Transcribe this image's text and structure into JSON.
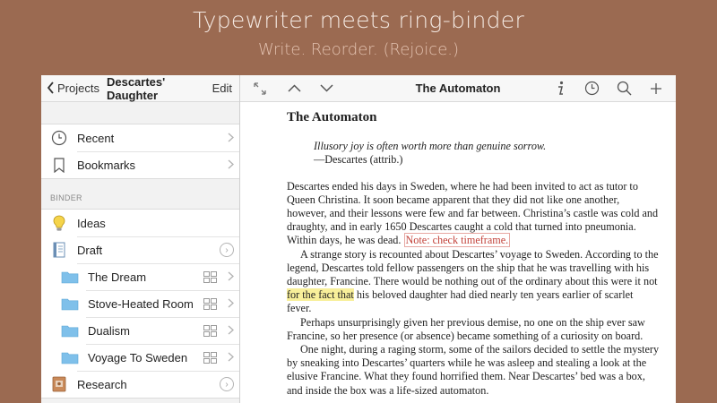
{
  "hero": {
    "title": "Typewriter meets ring-binder",
    "subtitle": "Write. Reorder. (Rejoice.)"
  },
  "sidebar": {
    "back_label": "Projects",
    "project_title": "Descartes' Daughter",
    "edit_label": "Edit",
    "top_items": [
      {
        "label": "Recent",
        "icon": "clock-icon"
      },
      {
        "label": "Bookmarks",
        "icon": "bookmark-icon"
      }
    ],
    "binder_header": "BINDER",
    "binder_items": [
      {
        "label": "Ideas",
        "icon": "lightbulb-icon"
      },
      {
        "label": "Draft",
        "icon": "document-icon"
      },
      {
        "label": "The Dream",
        "icon": "folder-icon"
      },
      {
        "label": "Stove-Heated Room",
        "icon": "folder-icon"
      },
      {
        "label": "Dualism",
        "icon": "folder-icon"
      },
      {
        "label": "Voyage To Sweden",
        "icon": "folder-icon"
      },
      {
        "label": "Research",
        "icon": "research-icon"
      }
    ]
  },
  "editor": {
    "title": "The Automaton",
    "doc_title": "The Automaton",
    "epigraph_quote": "Illusory joy is often worth more than genuine sorrow.",
    "epigraph_attrib": "—Descartes (attrib.)",
    "p1": "Descartes ended his days in Sweden, where he had been invited to act as tutor to Queen Christina. It soon became apparent that they did not like one another, however, and their lessons were few and far between. Christina’s castle was cold and draughty, and in early 1650 Descartes caught a cold that turned into pneumonia. Within days, he was dead. ",
    "note": "Note: check timeframe.",
    "p2_a": "A strange story is recounted about Descartes’ voyage to Sweden. According to the legend, Descartes told fellow passengers on the ship that he was travelling with his daughter, Francine. There would be nothing out of the ordinary about this were it not ",
    "p2_hl": "for the fact that",
    "p2_b": " his beloved daughter had died nearly ten years earlier of scarlet fever.",
    "p3": "Perhaps unsurprisingly given her previous demise, no one on the ship ever saw Francine, so her presence (or absence) became something of a curiosity on board.",
    "p4": "One night, during a raging storm, some of the sailors decided to settle the mystery by sneaking into Descartes’ quarters while he was asleep and stealing a look at the elusive Francine. What they found horrified them. Near Descartes’ bed was a box, and inside the box was a life-sized automaton."
  }
}
